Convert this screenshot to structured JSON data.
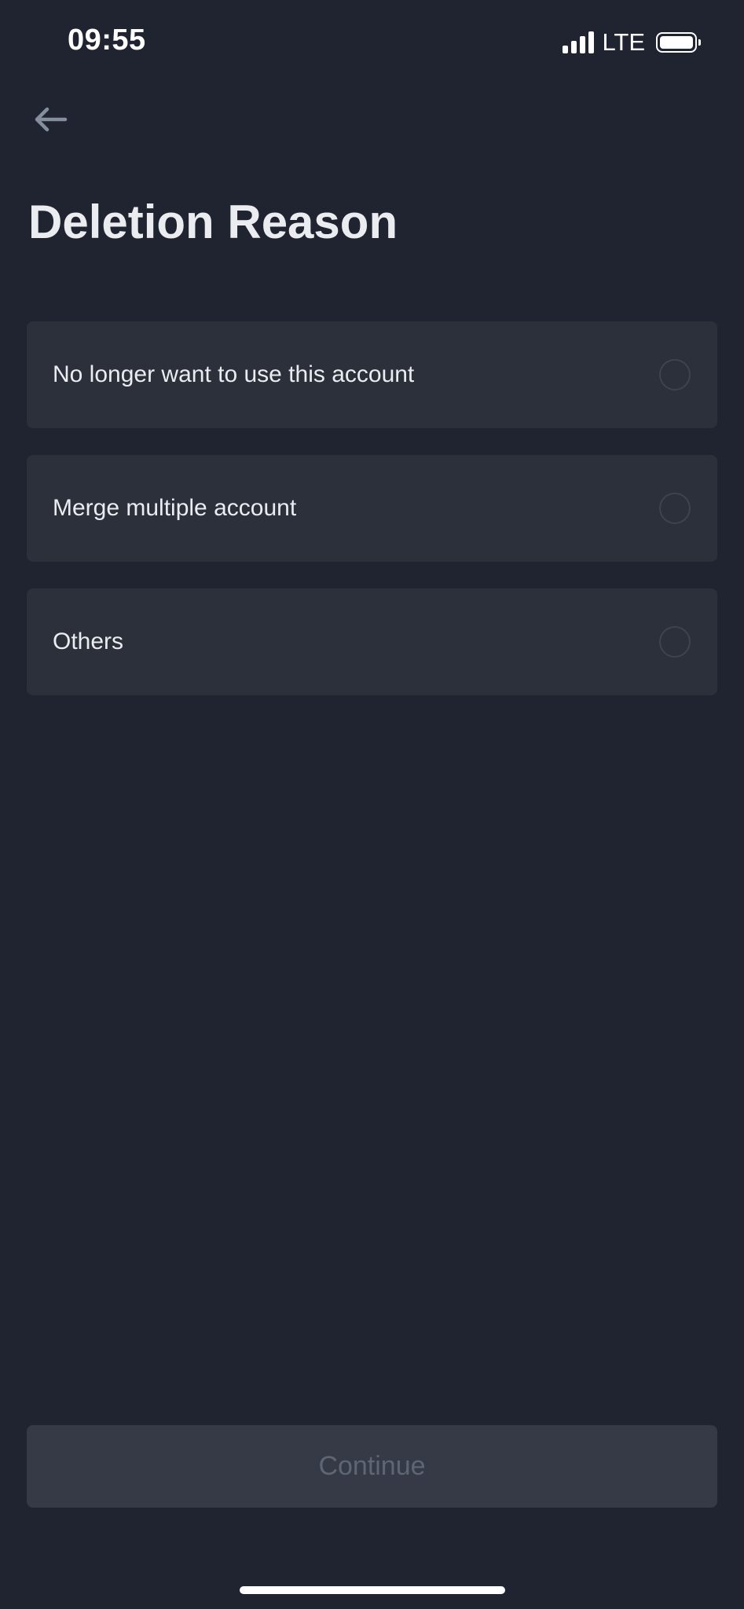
{
  "status_bar": {
    "time": "09:55",
    "network": "LTE",
    "signal_icon": "cellular-signal-icon",
    "battery_icon": "battery-icon"
  },
  "nav": {
    "back_icon": "back-arrow-icon"
  },
  "title": "Deletion Reason",
  "reasons": [
    {
      "label": "No longer want to use this account",
      "selected": false
    },
    {
      "label": "Merge multiple account",
      "selected": false
    },
    {
      "label": "Others",
      "selected": false
    }
  ],
  "continue_button": {
    "label": "Continue",
    "disabled": true
  },
  "colors": {
    "background": "#1f2430",
    "card": "#2b303b",
    "text_primary": "#eaecef",
    "text_disabled": "#5e6673",
    "button_disabled": "#353a46"
  }
}
